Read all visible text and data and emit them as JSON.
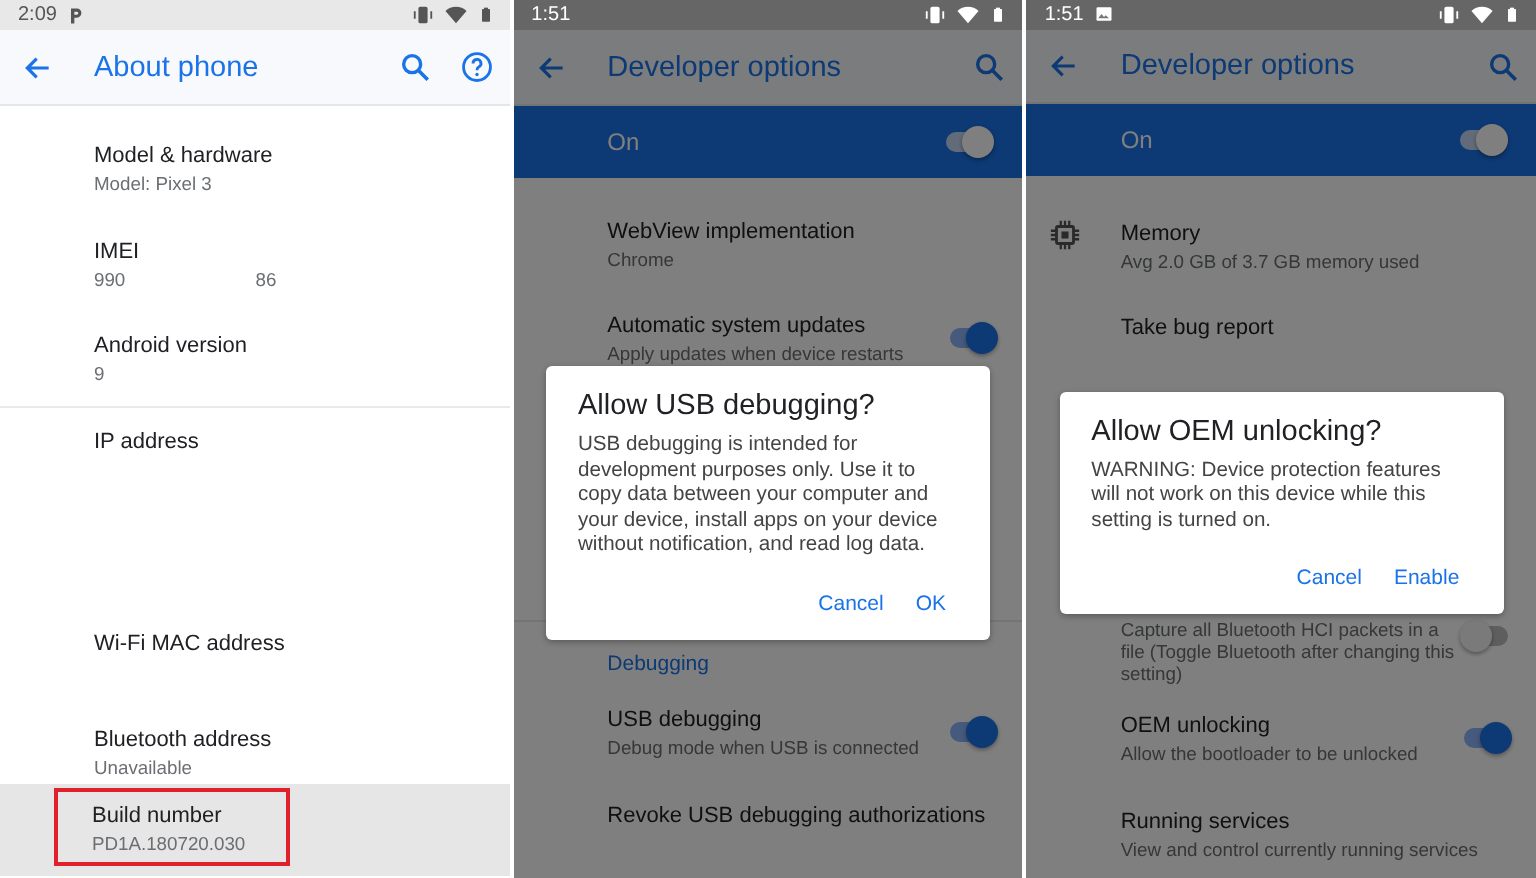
{
  "panels": [
    {
      "status_bar": {
        "time": "2:09",
        "notifications": [
          {
            "kind": "p-mark"
          }
        ]
      },
      "app_bar": {
        "title": "About phone",
        "actions": [
          {
            "kind": "search"
          },
          {
            "kind": "help"
          }
        ]
      },
      "items": [
        {
          "kind": "row",
          "title": "Model & hardware",
          "summary": "Model: Pixel 3",
          "highlighted": false,
          "annotated": false
        },
        {
          "kind": "row",
          "title": "IMEI",
          "summary": "990                         86",
          "highlighted": false,
          "annotated": false
        },
        {
          "kind": "row",
          "title": "Android version",
          "summary": "9",
          "highlighted": false,
          "annotated": false
        },
        {
          "kind": "divider"
        },
        {
          "kind": "row",
          "title": "IP address",
          "highlighted": false,
          "annotated": false
        },
        {
          "kind": "row",
          "title": "Wi-Fi MAC address",
          "highlighted": false,
          "annotated": false
        },
        {
          "kind": "row",
          "title": "Bluetooth address",
          "summary": "Unavailable",
          "highlighted": false,
          "annotated": false
        },
        {
          "kind": "row",
          "title": "Build number",
          "summary": "PD1A.180720.030",
          "highlighted": true,
          "annotated": true
        }
      ]
    },
    {
      "status_bar": {
        "time": "1:51"
      },
      "dimmed": true,
      "app_bar": {
        "title": "Developer options",
        "actions": [
          {
            "kind": "search"
          }
        ]
      },
      "master_switch": {
        "label": "On",
        "on": true
      },
      "items": [
        {
          "kind": "row",
          "title": "WebView implementation",
          "summary": "Chrome"
        },
        {
          "kind": "row",
          "title": "Automatic system updates",
          "summary": "Apply updates when device restarts",
          "toggle": {
            "on": true
          }
        },
        {
          "kind": "divider"
        },
        {
          "kind": "header",
          "title": "Debugging"
        },
        {
          "kind": "row",
          "title": "USB debugging",
          "summary": "Debug mode when USB is connected",
          "toggle": {
            "on": true
          }
        },
        {
          "kind": "row",
          "title": "Revoke USB debugging authorizations"
        }
      ],
      "dialog": {
        "title": "Allow USB debugging?",
        "message": "USB debugging is intended for development purposes only. Use it to copy data between your computer and your device, install apps on your device without notification, and read log data.",
        "actions": [
          "Cancel",
          "OK"
        ]
      }
    },
    {
      "status_bar": {
        "time": "1:51",
        "notifications": [
          {
            "kind": "image"
          }
        ]
      },
      "dimmed": true,
      "app_bar": {
        "title": "Developer options",
        "actions": [
          {
            "kind": "search"
          }
        ]
      },
      "master_switch": {
        "label": "On",
        "on": true
      },
      "items": [
        {
          "kind": "icon_row",
          "title": "Memory",
          "summary": "Avg 2.0 GB of 3.7 GB memory used"
        },
        {
          "kind": "row",
          "title": "Take bug report"
        },
        {
          "kind": "row",
          "summary": "Capture all Bluetooth HCI packets in a file (Toggle Bluetooth after changing this setting)",
          "toggle": {
            "on": false
          }
        },
        {
          "kind": "row",
          "title": "OEM unlocking",
          "summary": "Allow the bootloader to be unlocked",
          "toggle": {
            "on": true
          }
        },
        {
          "kind": "row",
          "title": "Running services",
          "summary": "View and control currently running services"
        }
      ],
      "dialog": {
        "title": "Allow OEM unlocking?",
        "message": "WARNING: Device protection features will not work on this device while this setting is turned on.",
        "actions": [
          "Cancel",
          "Enable"
        ]
      }
    }
  ]
}
